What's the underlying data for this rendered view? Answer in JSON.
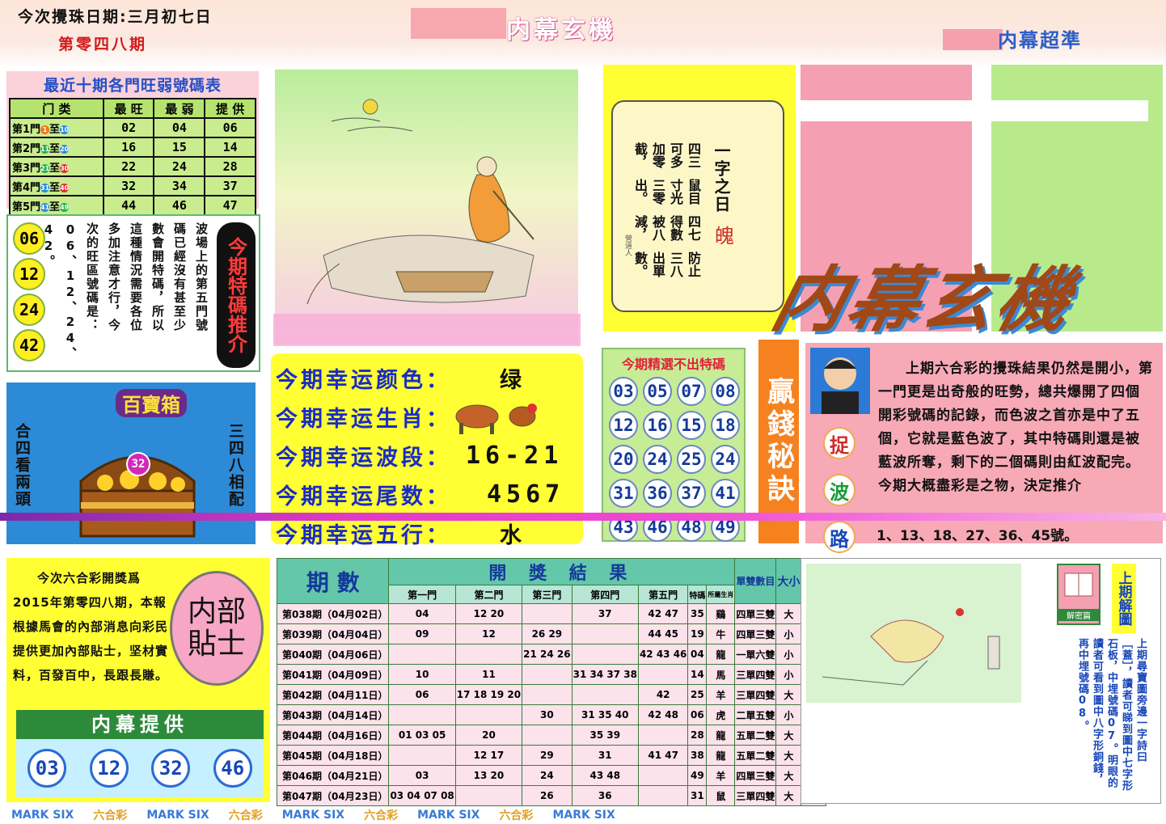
{
  "header": {
    "draw_date": "今次攪珠日期:三月初七日",
    "issue": "第零四八期",
    "title": "内幕玄機",
    "right_title": "内幕超準"
  },
  "weak_strong": {
    "title": "最近十期各門旺弱號碼表",
    "headers": [
      "门 类",
      "最 旺",
      "最 弱",
      "提 供"
    ],
    "rows": [
      {
        "label": "第1門",
        "from": "1",
        "to": "10",
        "hot": "02",
        "cold": "04",
        "pick": "06"
      },
      {
        "label": "第2門",
        "from": "11",
        "to": "20",
        "hot": "16",
        "cold": "15",
        "pick": "14"
      },
      {
        "label": "第3門",
        "from": "21",
        "to": "30",
        "hot": "22",
        "cold": "24",
        "pick": "28"
      },
      {
        "label": "第4門",
        "from": "31",
        "to": "40",
        "hot": "32",
        "cold": "34",
        "pick": "37"
      },
      {
        "label": "第5門",
        "from": "41",
        "to": "49",
        "hot": "44",
        "cold": "46",
        "pick": "47"
      }
    ]
  },
  "special_pick": {
    "title": "今期特碼推介",
    "balls": [
      "06",
      "12",
      "24",
      "42"
    ],
    "lines": [
      "波場上的第五門號",
      "碼已經沒有甚至少",
      "數會開特碼，所以",
      "這種情況需要各位",
      "多加注意才行，今",
      "次的旺區號碼是：",
      "06、12、24、42。"
    ]
  },
  "poem": {
    "title": "一字之日",
    "ghost": "魄",
    "lines": [
      "四三可多加零截，",
      "鼠目寸光三零出。",
      "四七得數被八減，",
      "防止三八出單數。"
    ],
    "signature": "營道人"
  },
  "treasure": {
    "title": "百寶箱",
    "left": "合四看兩頭",
    "right": "三四八相配",
    "ball": "32"
  },
  "lucky": {
    "rows": [
      {
        "label": "今期幸运颜色：",
        "value": "绿"
      },
      {
        "label": "今期幸运生肖：",
        "value": ""
      },
      {
        "label": "今期幸运波段：",
        "value": "16-21"
      },
      {
        "label": "今期幸运尾数：",
        "value": "4567"
      },
      {
        "label": "今期幸运五行：",
        "value": "水"
      }
    ]
  },
  "never": {
    "title": "今期精選不出特碼",
    "numbers": [
      "03",
      "05",
      "07",
      "08",
      "12",
      "16",
      "15",
      "18",
      "20",
      "24",
      "25",
      "24",
      "31",
      "36",
      "37",
      "41",
      "43",
      "46",
      "48",
      "49"
    ]
  },
  "secret": {
    "title": "贏錢秘訣",
    "chars": [
      "捉",
      "波",
      "路"
    ],
    "text": "上期六合彩的攪珠結果仍然是開小，第一門更是出奇般的旺勢，總共爆開了四個開彩號碼的記錄，而色波之首亦是中了五個，它就是藍色波了，其中特碼則還是被藍波所奪，剩下的二個碼則由紅波配完。今期大概盡彩是之物，決定推介",
    "numbers": "1、13、18、27、36、45號。"
  },
  "insider": {
    "text": "今次六合彩開獎爲2015年第零四八期，本報根據馬會的內部消息向彩民提供更加內部貼士，坚材實料，百發百中，長跟長賺。",
    "badge": "内部貼士",
    "provide_title": "内幕提供",
    "balls": [
      "03",
      "12",
      "32",
      "46"
    ]
  },
  "results": {
    "col_period": "期 數",
    "col_result": "開 獎 結 果",
    "col_count": "單雙數目",
    "col_size": "大小",
    "col_odd": "單雙",
    "sub": [
      "第一門",
      "第二門",
      "第三門",
      "第四門",
      "第五門",
      "特碼",
      "所屬生肖"
    ],
    "rows": [
      {
        "p": "第038期（04月02日）",
        "g1": "04",
        "g2": "12  20",
        "g3": "",
        "g4": "37",
        "g5": "42  47",
        "sp": "35",
        "z": "鷄",
        "c": "四單三雙",
        "s": "大",
        "o": "單"
      },
      {
        "p": "第039期（04月04日）",
        "g1": "09",
        "g2": "12",
        "g3": "26  29",
        "g4": "",
        "g5": "44  45",
        "sp": "19",
        "z": "牛",
        "c": "四單三雙",
        "s": "小",
        "o": "單"
      },
      {
        "p": "第040期（04月06日）",
        "g1": "",
        "g2": "",
        "g3": "21 24 26",
        "g4": "",
        "g5": "42 43 46",
        "sp": "04",
        "z": "龍",
        "c": "一單六雙",
        "s": "小",
        "o": "雙"
      },
      {
        "p": "第041期（04月09日）",
        "g1": "10",
        "g2": "11",
        "g3": "",
        "g4": "31 34 37 38",
        "g5": "",
        "sp": "14",
        "z": "馬",
        "c": "三單四雙",
        "s": "小",
        "o": "雙"
      },
      {
        "p": "第042期（04月11日）",
        "g1": "06",
        "g2": "17 18 19 20",
        "g3": "",
        "g4": "",
        "g5": "42",
        "sp": "25",
        "z": "羊",
        "c": "三單四雙",
        "s": "大",
        "o": "單"
      },
      {
        "p": "第043期（04月14日）",
        "g1": "",
        "g2": "",
        "g3": "30",
        "g4": "31  35  40",
        "g5": "42  48",
        "sp": "06",
        "z": "虎",
        "c": "二單五雙",
        "s": "小",
        "o": "雙"
      },
      {
        "p": "第044期（04月16日）",
        "g1": "01  03  05",
        "g2": "20",
        "g3": "",
        "g4": "35  39",
        "g5": "",
        "sp": "28",
        "z": "龍",
        "c": "五單二雙",
        "s": "大",
        "o": "雙"
      },
      {
        "p": "第045期（04月18日）",
        "g1": "",
        "g2": "12  17",
        "g3": "29",
        "g4": "31",
        "g5": "41  47",
        "sp": "38",
        "z": "龍",
        "c": "五單二雙",
        "s": "大",
        "o": "雙"
      },
      {
        "p": "第046期（04月21日）",
        "g1": "03",
        "g2": "13  20",
        "g3": "24",
        "g4": "43  48",
        "g5": "",
        "sp": "49",
        "z": "羊",
        "c": "四單三雙",
        "s": "大",
        "o": "單"
      },
      {
        "p": "第047期（04月23日）",
        "g1": "03 04 07 08",
        "g2": "",
        "g3": "26",
        "g4": "36",
        "g5": "",
        "sp": "31",
        "z": "鼠",
        "c": "三單四雙",
        "s": "大",
        "o": "單"
      }
    ]
  },
  "last": {
    "title": "上期解圖",
    "icon_label": "解密篇",
    "text": "上期尋寶圖旁邊一字詩曰［蓋］，讀者可睇到圖中七字形石板，中埋號碼07。明眼的讀者可看到圖中八字形銅錢，再中埋號碼08。"
  },
  "big_title": "内幕玄機",
  "footer": {
    "items": [
      "MARK SIX",
      "六合彩",
      "MARK SIX",
      "六合彩",
      "MARK SIX",
      "六合彩",
      "MARK SIX",
      "六合彩",
      "MARK SIX"
    ]
  },
  "colors": {
    "blue_text": "#1a2cc4",
    "pink": "#f5a0b5",
    "yellow": "#ffff33",
    "green_panel": "#c9ec8e"
  }
}
